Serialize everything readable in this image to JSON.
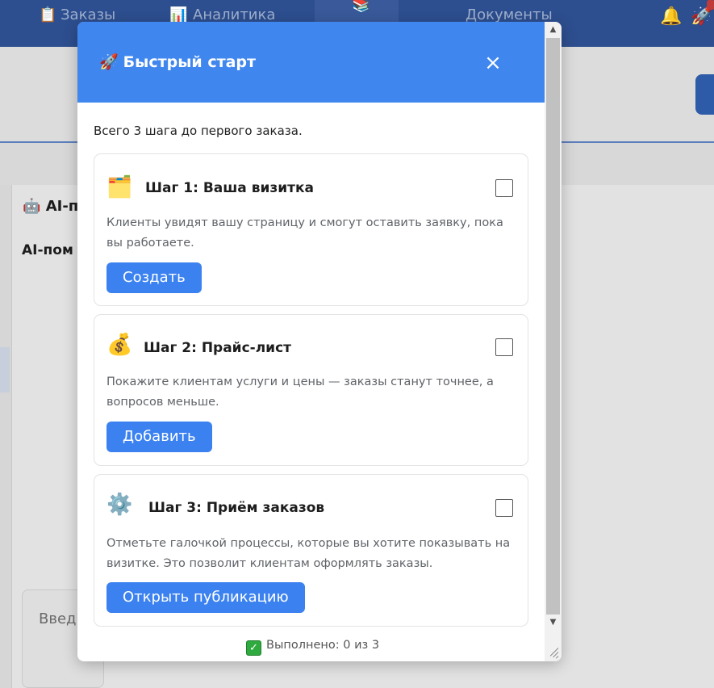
{
  "nav": {
    "orders_label": "Заказы",
    "analytics_label": "Аналитика",
    "documents_label": "Документы"
  },
  "background": {
    "ai_title": "AI-п",
    "ai_subtitle": "AI-пом",
    "input_placeholder": "Введ"
  },
  "modal": {
    "title": "Быстрый старт",
    "close_label": "×",
    "intro": "Всего 3 шага до первого заказа.",
    "steps": [
      {
        "icon": "business-card-icon",
        "title": "Шаг 1: Ваша визитка",
        "description": "Клиенты увидят вашу страницу и смогут оставить заявку, пока вы работаете.",
        "button": "Создать",
        "checked": false
      },
      {
        "icon": "money-bag-icon",
        "title": "Шаг 2: Прайс-лист",
        "description": "Покажите клиентам услуги и цены — заказы станут точнее, а вопросов меньше.",
        "button": "Добавить",
        "checked": false
      },
      {
        "icon": "gear-icon",
        "title": "Шаг 3: Приём заказов",
        "description": "Отметьте галочкой процессы, которые вы хотите показывать на визитке. Это позволит клиентам оформлять заказы.",
        "button": "Открыть публикацию",
        "checked": false
      }
    ],
    "progress_text": "Выполнено: 0 из 3",
    "progress_done": 0,
    "progress_total": 3
  },
  "colors": {
    "header": "#3f86ee",
    "button": "#3b82f0",
    "topbar": "#2d4e8f"
  }
}
